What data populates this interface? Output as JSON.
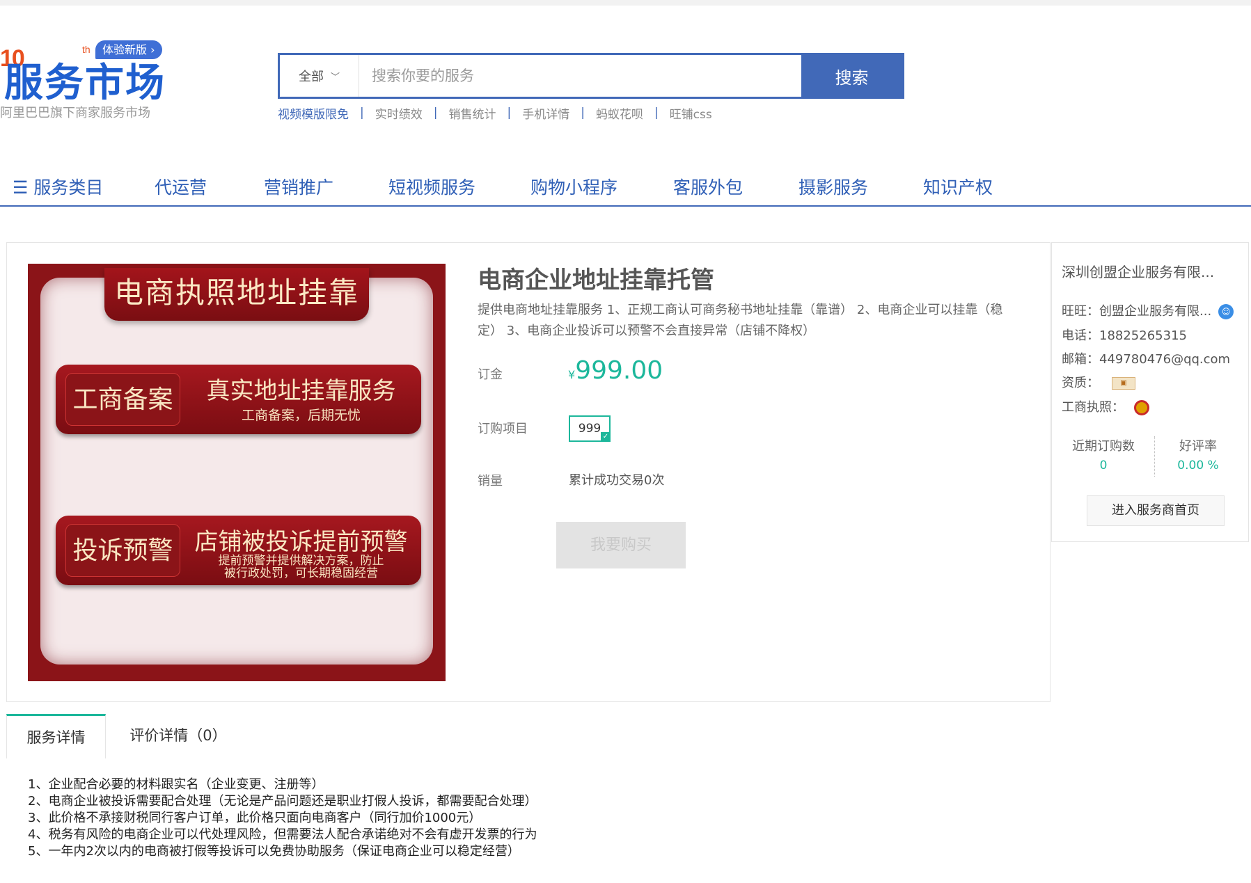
{
  "logo": {
    "num": "10",
    "sup": "th",
    "badge": "体验新版 ›",
    "title": "服务市场",
    "subtitle": "阿里巴巴旗下商家服务市场"
  },
  "search": {
    "scope": "全部",
    "placeholder": "搜索你要的服务",
    "button": "搜索",
    "hot": [
      "视频模版限免",
      "实时绩效",
      "销售统计",
      "手机详情",
      "蚂蚁花呗",
      "旺铺css"
    ]
  },
  "nav": {
    "menu_icon": "☰",
    "items": [
      "服务类目",
      "代运营",
      "营销推广",
      "短视频服务",
      "购物小程序",
      "客服外包",
      "摄影服务",
      "知识产权"
    ]
  },
  "banner": {
    "ribbon": "电商执照地址挂靠",
    "card1": {
      "tag": "工商备案",
      "main": "真实地址挂靠服务",
      "sub": "工商备案，后期无忧"
    },
    "card2": {
      "tag": "投诉预警",
      "main": "店铺被投诉提前预警",
      "sub_line1": "提前预警并提供解决方案，防止",
      "sub_line2": "被行政处罚，可长期稳固经营"
    }
  },
  "product": {
    "title": "电商企业地址挂靠托管",
    "description": "提供电商地址挂靠服务 1、正规工商认可商务秘书地址挂靠（靠谱） 2、电商企业可以挂靠（稳定） 3、电商企业投诉可以预警不会直接异常（店铺不降权）",
    "deposit_label": "订金",
    "currency": "¥",
    "price": "999.00",
    "option_label": "订购项目",
    "option_value": "999",
    "sales_label": "销量",
    "sales_value": "累计成功交易0次",
    "buy_button": "我要购买"
  },
  "seller": {
    "name": "深圳创盟企业服务有限...",
    "wangwang": "旺旺：创盟企业服务有限...",
    "phone": "电话：18825265315",
    "email": "邮箱：449780476@qq.com",
    "qualification": "资质：",
    "license": "工商执照：",
    "stats": {
      "orders_label": "近期订购数",
      "orders_value": "0",
      "rating_label": "好评率",
      "rating_value": "0.00 %"
    },
    "enter_button": "进入服务商首页",
    "accent_color": "#1cb79b"
  },
  "tabs": [
    "服务详情",
    "评价详情（0）"
  ],
  "details": [
    "1、企业配合必要的材料跟实名（企业变更、注册等）",
    "2、电商企业被投诉需要配合处理（无论是产品问题还是职业打假人投诉，都需要配合处理）",
    "3、此价格不承接财税同行客户订单，此价格只面向电商客户（同行加价1000元）",
    "4、税务有风险的电商企业可以代处理风险，但需要法人配合承诺绝对不会有虚开发票的行为",
    "5、一年内2次以内的电商被打假等投诉可以免费协助服务（保证电商企业可以稳定经营）"
  ]
}
